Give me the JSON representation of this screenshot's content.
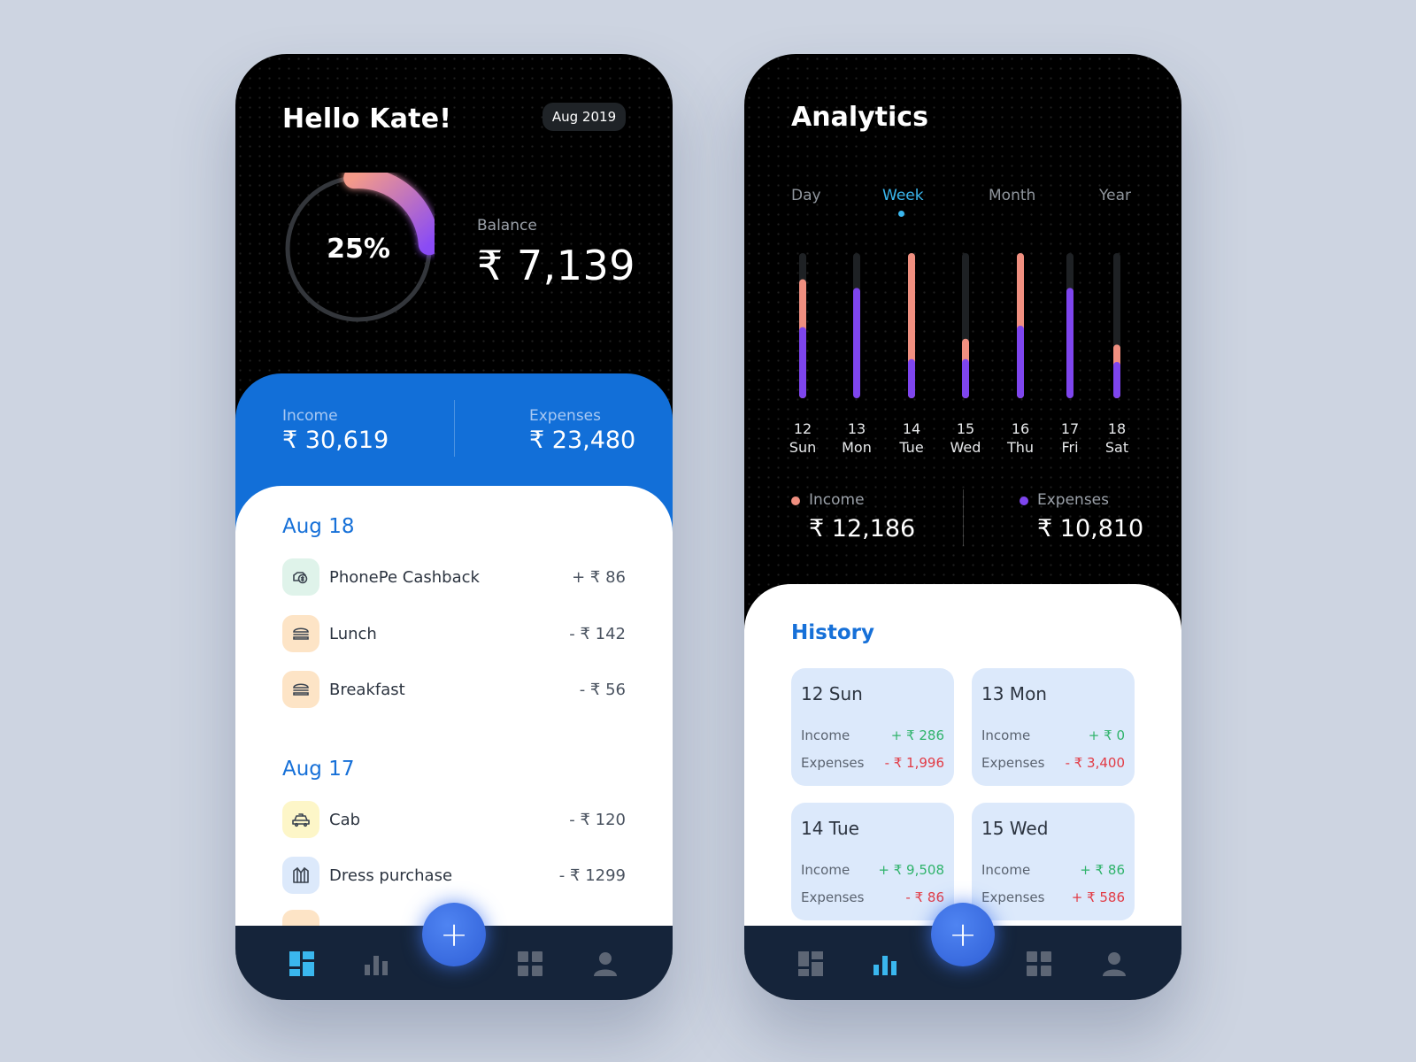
{
  "home": {
    "greeting": "Hello Kate!",
    "month": "Aug 2019",
    "ring_percent": "25%",
    "ring_fraction": 0.25,
    "balance_label": "Balance",
    "balance_value": "₹ 7,139",
    "income_label": "Income",
    "income_value": "₹ 30,619",
    "expenses_label": "Expenses",
    "expenses_value": "₹ 23,480",
    "groups": [
      {
        "date": "Aug 18",
        "items": [
          {
            "name": "PhonePe Cashback",
            "amount": "+ ₹ 86",
            "icon": "cashback-icon"
          },
          {
            "name": "Lunch",
            "amount": "- ₹ 142",
            "icon": "burger-icon"
          },
          {
            "name": "Breakfast",
            "amount": "- ₹ 56",
            "icon": "burger-icon"
          }
        ]
      },
      {
        "date": "Aug 17",
        "items": [
          {
            "name": "Cab",
            "amount": "- ₹ 120",
            "icon": "taxi-icon"
          },
          {
            "name": "Dress purchase",
            "amount": "- ₹ 1299",
            "icon": "shirt-icon"
          }
        ]
      }
    ]
  },
  "analytics": {
    "title": "Analytics",
    "tabs": [
      "Day",
      "Week",
      "Month",
      "Year"
    ],
    "active_tab": "Week",
    "income_label": "Income",
    "income_value": "₹ 12,186",
    "expenses_label": "Expenses",
    "expenses_value": "₹ 10,810",
    "history_title": "History",
    "history": [
      {
        "day": "12 Sun",
        "income_label": "Income",
        "income": "+ ₹ 286",
        "expenses_label": "Expenses",
        "expenses": "- ₹ 1,996"
      },
      {
        "day": "13 Mon",
        "income_label": "Income",
        "income": "+ ₹ 0",
        "expenses_label": "Expenses",
        "expenses": "- ₹ 3,400"
      },
      {
        "day": "14 Tue",
        "income_label": "Income",
        "income": "+ ₹ 9,508",
        "expenses_label": "Expenses",
        "expenses": "- ₹ 86"
      },
      {
        "day": "15 Wed",
        "income_label": "Income",
        "income": "+ ₹ 86",
        "expenses_label": "Expenses",
        "expenses": "+ ₹ 586"
      }
    ]
  },
  "chart_data": {
    "type": "bar",
    "categories": [
      "12 Sun",
      "13 Mon",
      "14 Tue",
      "15 Wed",
      "16 Thu",
      "17 Fri",
      "18 Sat"
    ],
    "day_numbers": [
      "12",
      "13",
      "14",
      "15",
      "16",
      "17",
      "18"
    ],
    "day_names": [
      "Sun",
      "Mon",
      "Tue",
      "Wed",
      "Thu",
      "Fri",
      "Sat"
    ],
    "series": [
      {
        "name": "Income",
        "values": [
          0.82,
          0.0,
          1.0,
          0.41,
          1.0,
          0.0,
          0.37
        ],
        "color": "#f08f80"
      },
      {
        "name": "Expenses",
        "values": [
          0.49,
          0.76,
          0.27,
          0.27,
          0.5,
          0.76,
          0.25
        ],
        "color": "#7e45ee"
      }
    ],
    "ylim": [
      0,
      1
    ],
    "legend": "bottom"
  },
  "nav": {
    "items": [
      "dashboard-icon",
      "chart-icon",
      "add-icon",
      "grid-icon",
      "profile-icon"
    ],
    "fab_label": "+"
  },
  "colors": {
    "background": "#cdd4e1",
    "primary_blue": "#126fd8",
    "income": "#f08f80",
    "expenses": "#7e45ee",
    "accent": "#3ab7ee",
    "nav_bg": "#15243a",
    "positive": "#2fb36b",
    "negative": "#e23b45"
  }
}
